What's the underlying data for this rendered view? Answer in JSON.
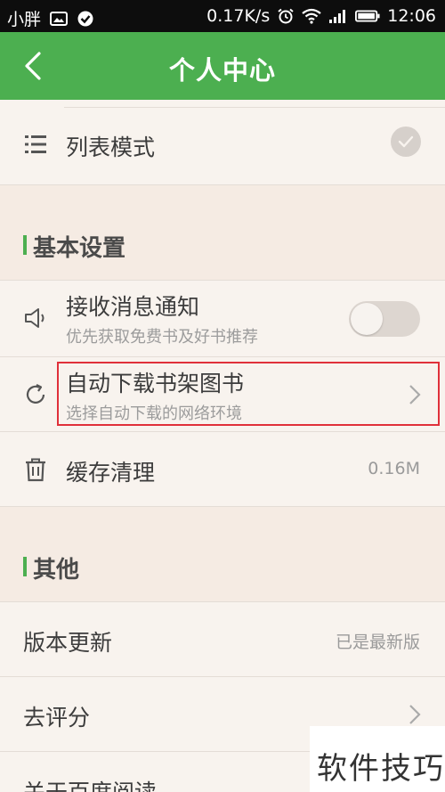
{
  "status_bar": {
    "carrier": "小胖",
    "network_speed": "0.17K/s",
    "time": "12:06",
    "icons": [
      "image-icon",
      "check-badge-icon",
      "alarm-icon",
      "wifi-icon",
      "signal-icon",
      "battery-icon"
    ]
  },
  "header": {
    "title": "个人中心",
    "back_icon": "chevron-left-icon"
  },
  "list_mode": {
    "label": "列表模式",
    "icon": "list-icon",
    "checked": true
  },
  "section_basic": {
    "label": "基本设置"
  },
  "notifications": {
    "label": "接收消息通知",
    "description": "优先获取免费书及好书推荐",
    "icon": "speaker-icon",
    "enabled": false
  },
  "auto_download": {
    "label": "自动下载书架图书",
    "description": "选择自动下载的网络环境",
    "icon": "refresh-icon"
  },
  "cache": {
    "label": "缓存清理",
    "value": "0.16M",
    "icon": "trash-icon"
  },
  "section_other": {
    "label": "其他"
  },
  "version": {
    "label": "版本更新",
    "value": "已是最新版"
  },
  "rate": {
    "label": "去评分"
  },
  "about": {
    "label": "关于百度阅读"
  },
  "watermark": {
    "text": "软件技巧"
  },
  "colors": {
    "accent": "#4caf50",
    "background": "#f8f3ee",
    "section_background": "#f5ebe3",
    "highlight_border": "#e0303a"
  }
}
